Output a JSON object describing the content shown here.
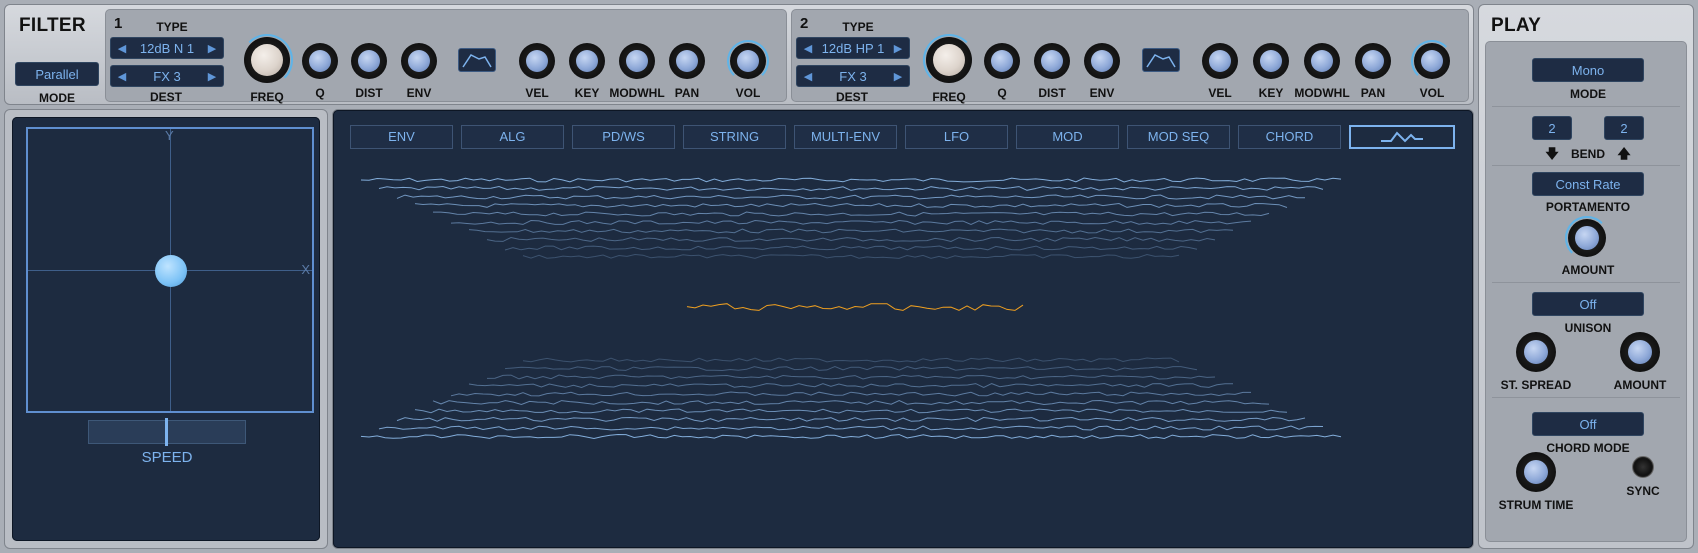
{
  "filter": {
    "title": "FILTER",
    "mode_value": "Parallel",
    "mode_label": "MODE",
    "type_label": "TYPE",
    "dest_label": "DEST",
    "filter1": {
      "number": "1",
      "type": "12dB N 1",
      "dest": "FX 3"
    },
    "filter2": {
      "number": "2",
      "type": "12dB HP 1",
      "dest": "FX 3"
    },
    "knob_labels": {
      "freq": "FREQ",
      "q": "Q",
      "dist": "DIST",
      "env": "ENV",
      "vel": "VEL",
      "key": "KEY",
      "modwhl": "MODWHL",
      "pan": "PAN",
      "vol": "VOL"
    }
  },
  "xy_pad": {
    "y_label": "Y",
    "x_label": "X",
    "speed_label": "SPEED"
  },
  "tabs": [
    {
      "label": "ENV"
    },
    {
      "label": "ALG"
    },
    {
      "label": "PD/WS"
    },
    {
      "label": "STRING"
    },
    {
      "label": "MULTI-ENV"
    },
    {
      "label": "LFO"
    },
    {
      "label": "MOD"
    },
    {
      "label": "MOD SEQ"
    },
    {
      "label": "CHORD"
    },
    {
      "label": ""
    }
  ],
  "play": {
    "title": "PLAY",
    "mode_value": "Mono",
    "mode_label": "MODE",
    "bend_down": "2",
    "bend_up": "2",
    "bend_label": "BEND",
    "portamento_value": "Const Rate",
    "portamento_label": "PORTAMENTO",
    "amount_label": "AMOUNT",
    "unison_value": "Off",
    "unison_label": "UNISON",
    "st_spread_label": "ST. SPREAD",
    "unison_amount_label": "AMOUNT",
    "chord_mode_value": "Off",
    "chord_mode_label": "CHORD MODE",
    "strum_time_label": "STRUM TIME",
    "sync_label": "SYNC"
  },
  "colors": {
    "accent": "#7db3ee",
    "panel_dark": "#1d2b40",
    "active_wave": "#f0a020"
  }
}
